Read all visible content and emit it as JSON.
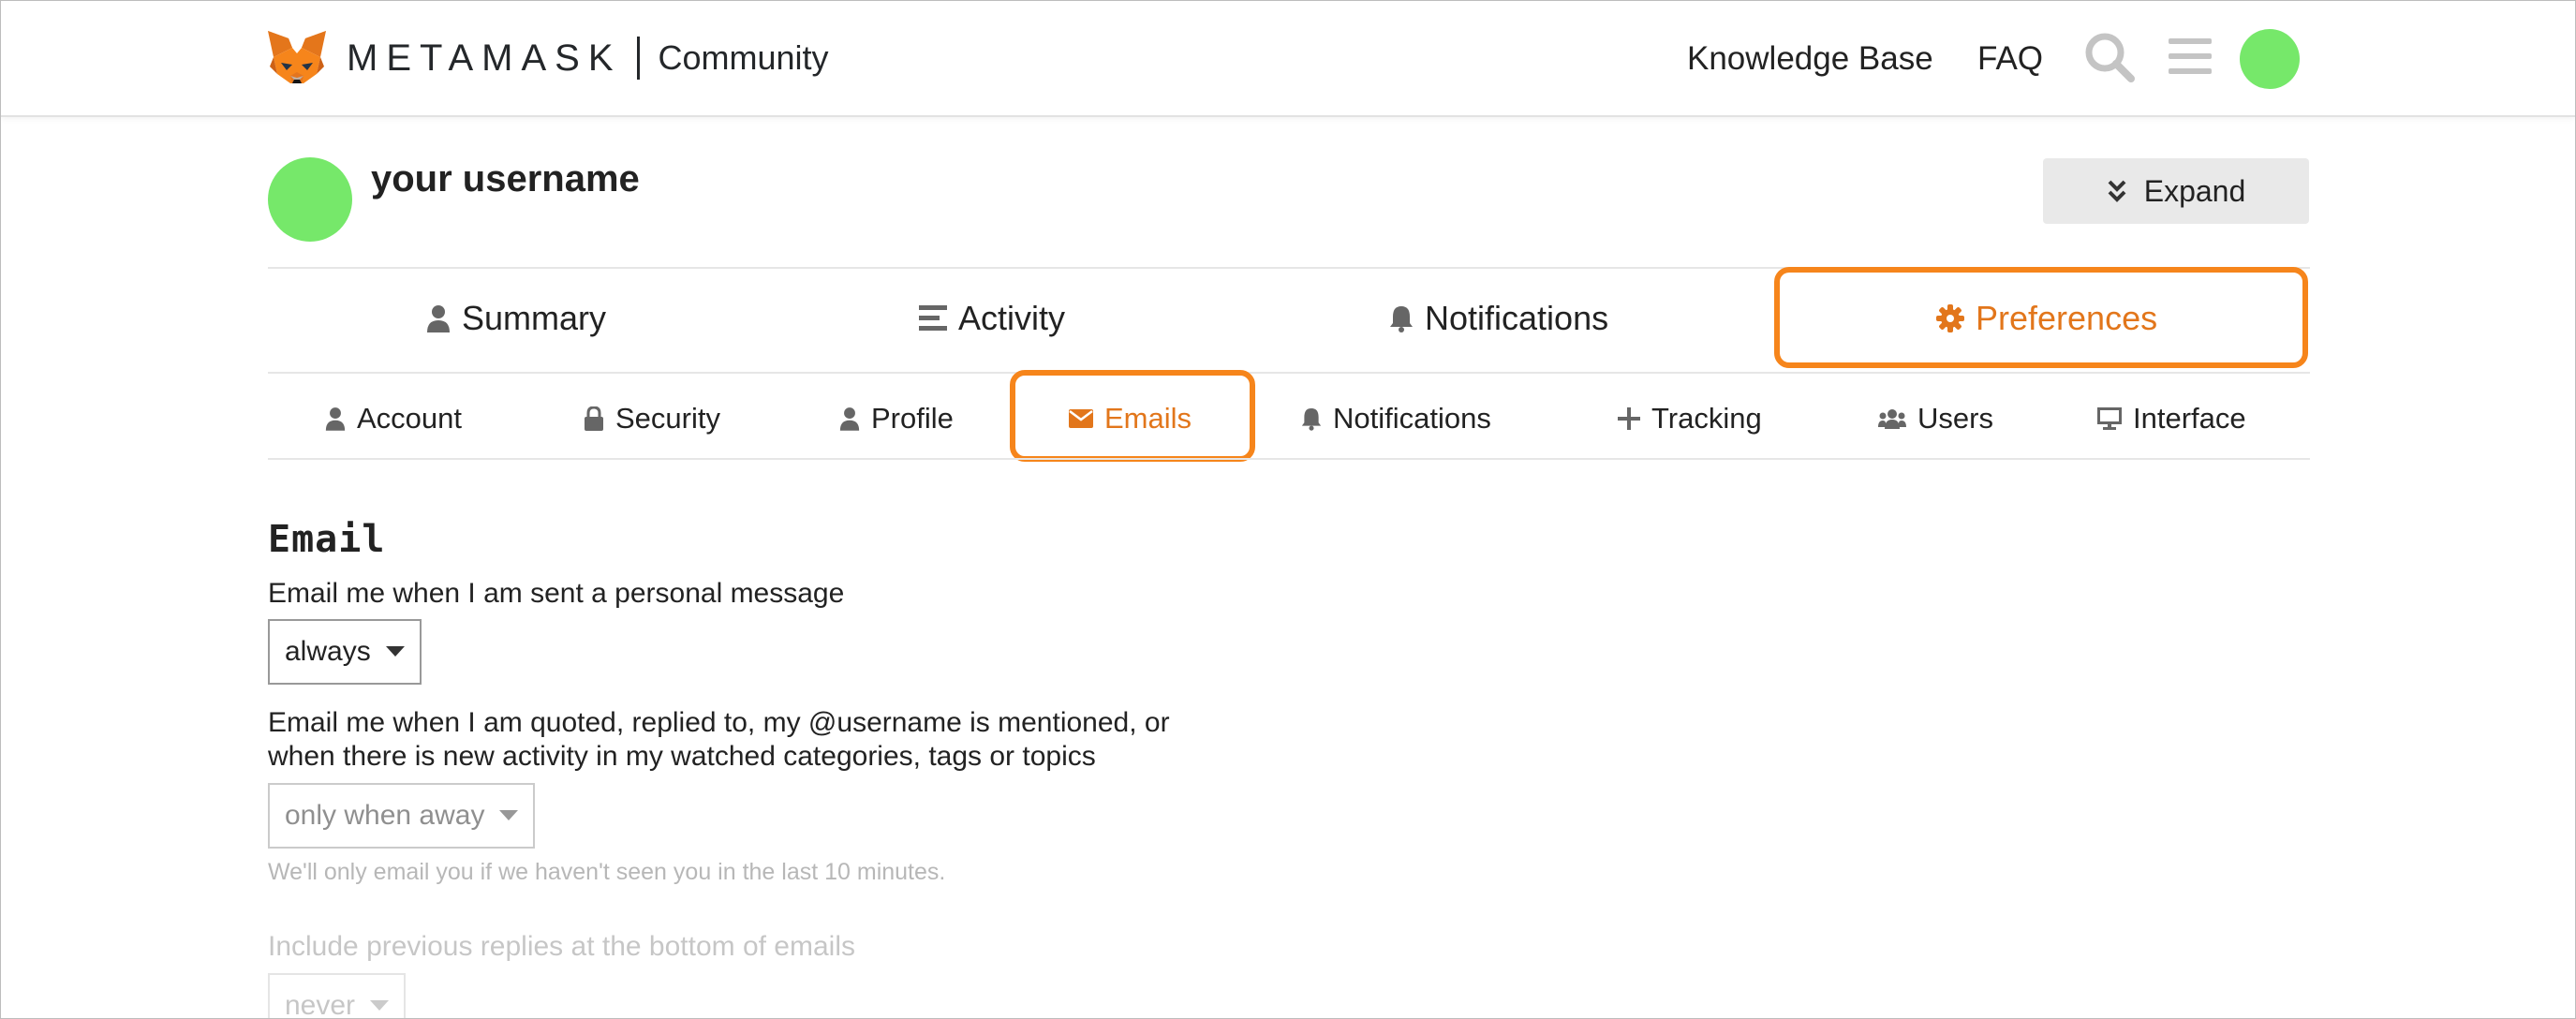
{
  "header": {
    "brand": "METAMASK",
    "community": "Community",
    "links": {
      "knowledge_base": "Knowledge Base",
      "faq": "FAQ"
    },
    "icons": [
      "fox-logo-icon",
      "search-icon",
      "hamburger-menu-icon"
    ]
  },
  "user": {
    "name": "your username",
    "avatar_color": "#76e86a"
  },
  "expand_button": {
    "label": "Expand"
  },
  "main_nav": {
    "summary": "Summary",
    "activity": "Activity",
    "notifications": "Notifications",
    "preferences": "Preferences",
    "active": "Preferences"
  },
  "sub_nav": {
    "account": "Account",
    "security": "Security",
    "profile": "Profile",
    "emails": "Emails",
    "notifications": "Notifications",
    "tracking": "Tracking",
    "users": "Users",
    "interface": "Interface",
    "active": "Emails"
  },
  "content": {
    "section_title": "Email",
    "personal_message": {
      "label": "Email me when I am sent a personal message",
      "value": "always"
    },
    "quoted": {
      "label_line1": "Email me when I am quoted, replied to, my @username is mentioned, or",
      "label_line2": "when there is new activity in my watched categories, tags or topics",
      "value": "only when away",
      "hint": "We'll only email you if we haven't seen you in the last 10 minutes."
    },
    "previous_replies": {
      "label": "Include previous replies at the bottom of emails",
      "value": "never"
    }
  },
  "colors": {
    "accent": "#f6851b",
    "accent_text": "#e2761b",
    "avatar": "#76e86a"
  }
}
